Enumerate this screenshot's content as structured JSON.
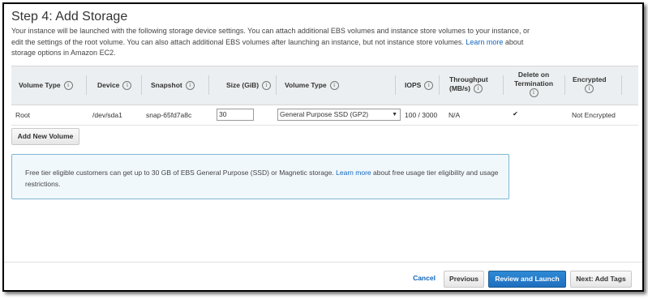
{
  "page": {
    "title": "Step 4: Add Storage",
    "description_part1": "Your instance will be launched with the following storage device settings. You can attach additional EBS volumes and instance store volumes to your instance, or edit the settings of the root volume. You can also attach additional EBS volumes after launching an instance, but not instance store volumes.",
    "description_link": "Learn more",
    "description_part2": "about storage options in Amazon EC2."
  },
  "table": {
    "headers": {
      "volume_type": "Volume Type",
      "device": "Device",
      "snapshot": "Snapshot",
      "size": "Size (GiB)",
      "volume_type2": "Volume Type",
      "iops": "IOPS",
      "throughput_line1": "Throughput",
      "throughput_line2": "(MB/s)",
      "delete_line1": "Delete on",
      "delete_line2": "Termination",
      "encrypted": "Encrypted"
    },
    "rows": [
      {
        "volume_type": "Root",
        "device": "/dev/sda1",
        "snapshot": "snap-65fd7a8c",
        "size": "30",
        "volume_type_selected": "General Purpose SSD (GP2)",
        "iops": "100 / 3000",
        "throughput": "N/A",
        "delete_on_termination": true,
        "encrypted": "Not Encrypted"
      }
    ],
    "info_glyph": "i",
    "checkbox_glyph": "✔",
    "dropdown_glyph": "▼"
  },
  "add_volume_label": "Add New Volume",
  "notice": {
    "text_part1": "Free tier eligible customers can get up to 30 GB of EBS General Purpose (SSD) or Magnetic storage.",
    "link": "Learn more",
    "text_part2": "about free usage tier eligibility and usage restrictions."
  },
  "footer": {
    "cancel": "Cancel",
    "previous": "Previous",
    "review_launch": "Review and Launch",
    "next": "Next: Add Tags"
  },
  "colors": {
    "link": "#1166bb",
    "primary_button": "#1f6fbf",
    "notice_border": "#7fb7d3",
    "notice_bg": "#f1f8fc",
    "header_bg": "#eceff1"
  }
}
